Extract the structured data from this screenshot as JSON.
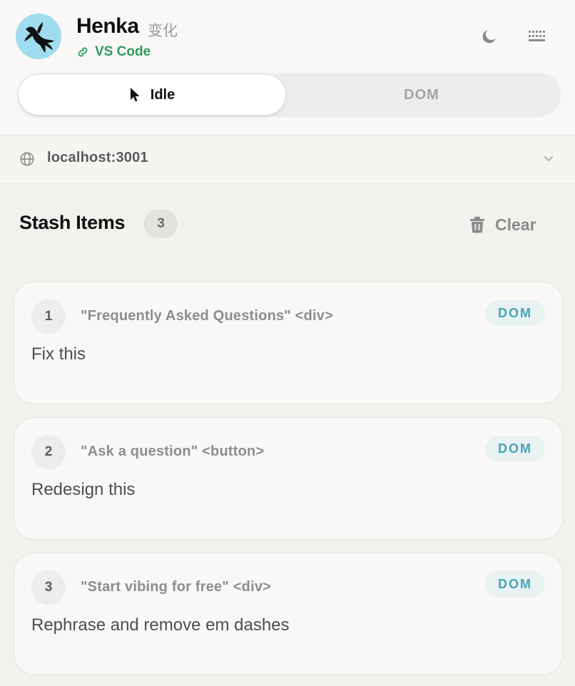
{
  "header": {
    "app_name": "Henka",
    "app_name_native": "变化",
    "connection_label": "VS Code",
    "connection_color": "#2e9a5c",
    "avatar_bg": "#9fdcef",
    "actions": [
      {
        "icon": "moon-icon"
      },
      {
        "icon": "keyboard-icon"
      }
    ]
  },
  "mode_toggle": {
    "options": [
      {
        "label": "Idle",
        "icon": "cursor-arrow-icon",
        "active": true
      },
      {
        "label": "DOM",
        "active": false
      }
    ]
  },
  "url_selector": {
    "value": "localhost:3001",
    "icon": "globe-icon"
  },
  "stash": {
    "title": "Stash Items",
    "count": "3",
    "clear_label": "Clear",
    "items": [
      {
        "index": "1",
        "target": "\"Frequently Asked Questions\" <div>",
        "type": "DOM",
        "note": "Fix this"
      },
      {
        "index": "2",
        "target": "\"Ask a question\" <button>",
        "type": "DOM",
        "note": "Redesign this"
      },
      {
        "index": "3",
        "target": "\"Start vibing for free\" <div>",
        "type": "DOM",
        "note": "Rephrase and remove em dashes"
      }
    ]
  },
  "colors": {
    "accent_teal": "#4aa3b8",
    "badge_bg": "#e7f2f3",
    "page_bg": "#f2f1ee"
  }
}
